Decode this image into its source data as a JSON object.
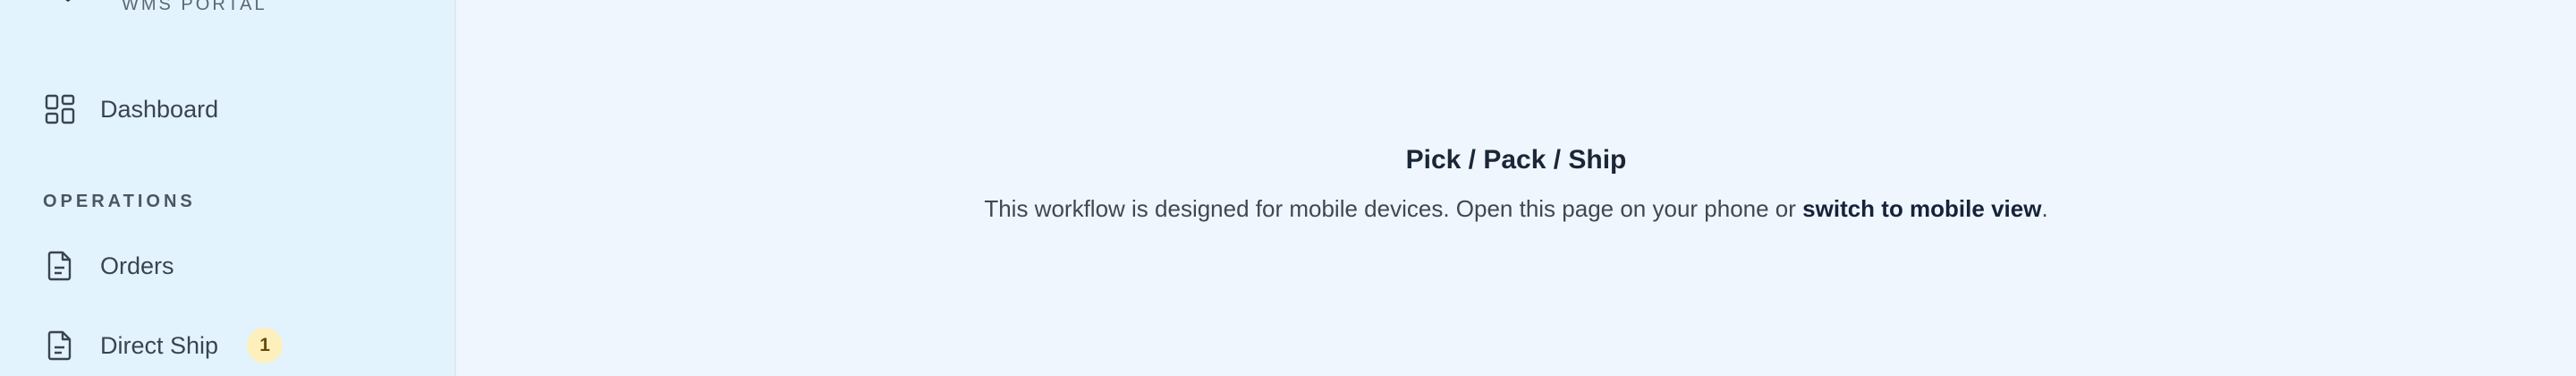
{
  "brand": {
    "subtitle": "WMS PORTAL"
  },
  "sidebar": {
    "dashboard_label": "Dashboard",
    "section_operations": "OPERATIONS",
    "items": [
      {
        "label": "Orders",
        "icon": "document-icon"
      },
      {
        "label": "Direct Ship",
        "icon": "document-icon",
        "badge": "1"
      }
    ]
  },
  "main": {
    "title": "Pick / Pack / Ship",
    "message_prefix": "This workflow is designed for mobile devices. Open this page on your phone or ",
    "message_link": "switch to mobile view",
    "message_suffix": "."
  },
  "colors": {
    "sidebar_bg": "#e3f3fd",
    "main_bg": "#f0f6fd",
    "badge_bg": "#fdf0bd",
    "logo_accent": "#1b6f9a"
  }
}
